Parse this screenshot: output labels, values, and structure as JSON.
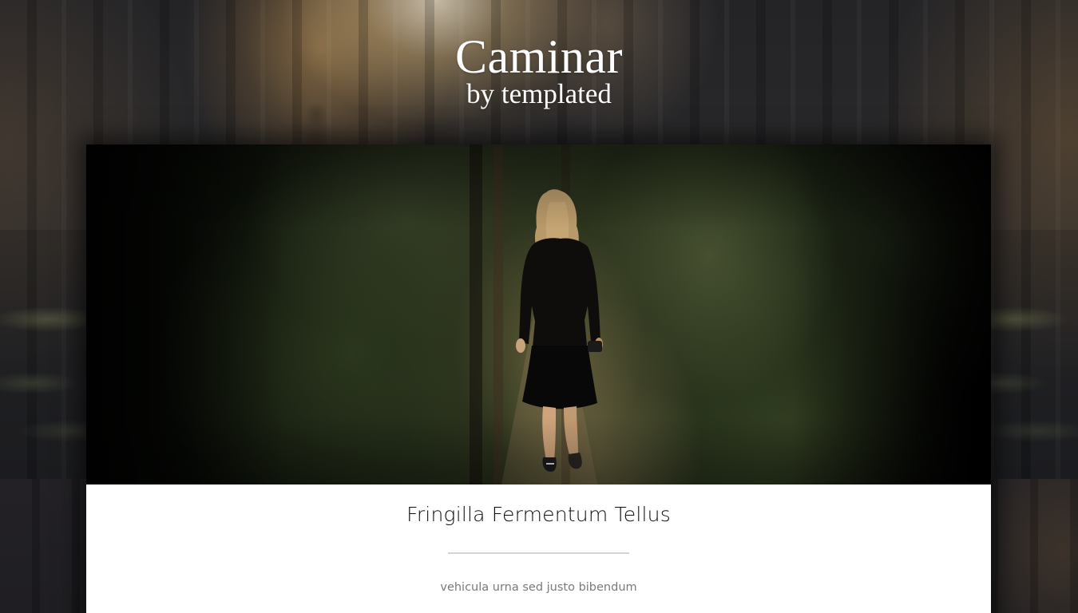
{
  "header": {
    "title": "Caminar",
    "subtitle": "by templated"
  },
  "post": {
    "image_alt": "hiker-on-forest-trail-photo",
    "title": "Fringilla Fermentum Tellus",
    "excerpt": "vehicula urna sed justo bibendum"
  },
  "colors": {
    "card_background": "#ffffff",
    "title_text": "#111111",
    "excerpt_text": "#7a7a7a",
    "divider": "#d4d4d4",
    "header_text": "#ffffff"
  }
}
